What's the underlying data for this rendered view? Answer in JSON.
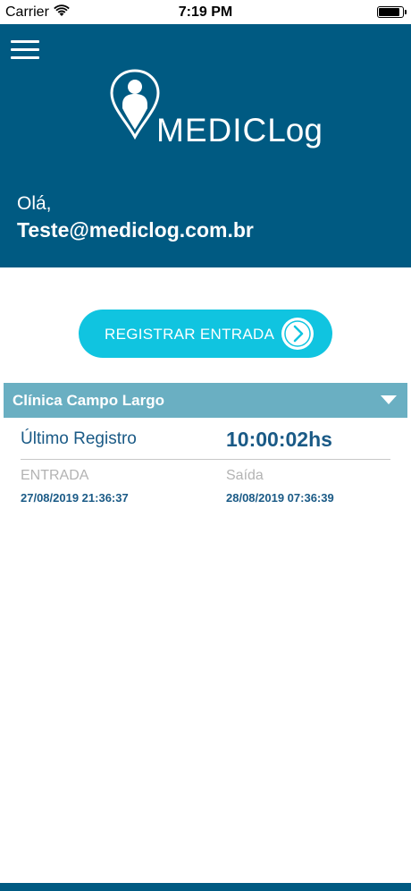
{
  "status_bar": {
    "carrier": "Carrier",
    "time": "7:19 PM",
    "battery_level": 0.9,
    "icons": [
      "wifi-icon",
      "battery-icon"
    ]
  },
  "header": {
    "logo_text_thin": "MEDIC",
    "logo_text_bold": "Log",
    "greeting": "Olá,",
    "user_email": "Teste@mediclog.com.br",
    "background_color": "#005a82"
  },
  "actions": {
    "register_label": "REGISTRAR ENTRADA",
    "button_color": "#10c4e0"
  },
  "clinic": {
    "name": "Clínica Campo Largo"
  },
  "record": {
    "last_label": "Último Registro",
    "last_value": "10:00:02hs",
    "entry_label": "ENTRADA",
    "entry_value": "27/08/2019 21:36:37",
    "exit_label": "Saída",
    "exit_value": "28/08/2019 07:36:39"
  }
}
